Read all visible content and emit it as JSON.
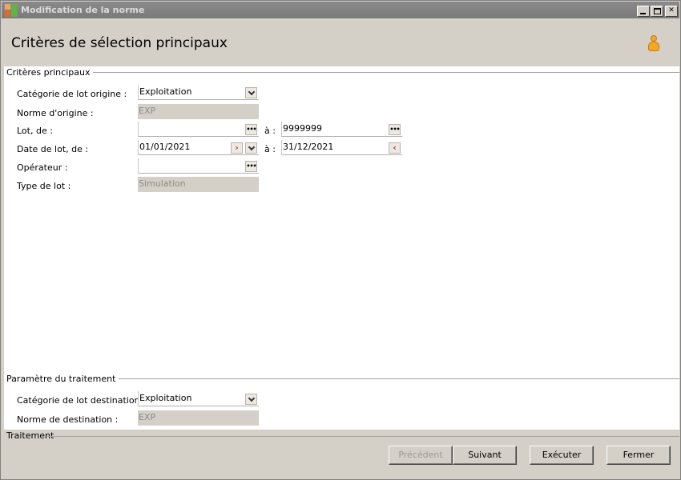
{
  "window": {
    "title": "Modification de la norme"
  },
  "header": {
    "title": "Critères de sélection principaux"
  },
  "sections": {
    "main": "Critères principaux",
    "params": "Paramètre du traitement",
    "processing": "Traitement"
  },
  "form": {
    "categorie_origine": {
      "label": "Catégorie de lot origine :",
      "value": "Exploitation"
    },
    "norme_origine": {
      "label": "Norme d'origine :",
      "value": "EXP"
    },
    "lot": {
      "label": "Lot, de :",
      "from": "",
      "to_label": "à :",
      "to": "9999999"
    },
    "date_lot": {
      "label": "Date de lot, de :",
      "from": "01/01/2021",
      "to_label": "à :",
      "to": "31/12/2021"
    },
    "operateur": {
      "label": "Opérateur :",
      "value": ""
    },
    "type_lot": {
      "label": "Type de lot :",
      "value": "Simulation"
    },
    "categorie_destination": {
      "label": "Catégorie de lot destination :",
      "value": "Exploitation"
    },
    "norme_destination": {
      "label": "Norme de destination :",
      "value": "EXP"
    }
  },
  "buttons": {
    "precedent": "Précédent",
    "suivant": "Suivant",
    "executer": "Exécuter",
    "fermer": "Fermer"
  },
  "icons": {
    "app": "app-icon",
    "user": "user-icon",
    "ellipsis": "ellipsis-icon",
    "dropdown": "chevron-down-icon",
    "calendar": "calendar-arrow-icon"
  },
  "colors": {
    "titlebar": "#7a7a7a",
    "window_bg": "#d4d0c8",
    "user_icon": "#f5a623"
  }
}
